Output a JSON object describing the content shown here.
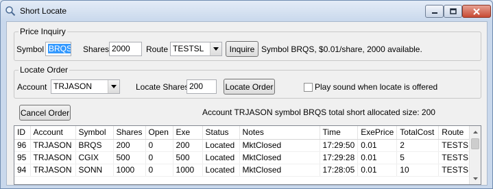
{
  "window": {
    "title": "Short Locate",
    "icon": "search-icon"
  },
  "price_inquiry": {
    "legend": "Price Inquiry",
    "symbol_label": "Symbol",
    "symbol_value": "BRQS",
    "shares_label": "Shares",
    "shares_value": "2000",
    "route_label": "Route",
    "route_value": "TESTSL",
    "inquire_button": "Inquire",
    "result_text": "Symbol BRQS, $0.01/share, 2000 available."
  },
  "locate_order": {
    "legend": "Locate Order",
    "account_label": "Account",
    "account_value": "TRJASON",
    "locate_shares_label": "Locate Shares",
    "locate_shares_value": "200",
    "locate_order_button": "Locate Order",
    "play_sound_label": "Play sound when locate is offered",
    "play_sound_checked": false
  },
  "cancel_order_button": "Cancel Order",
  "summary_text": "Account TRJASON symbol BRQS total short allocated size: 200",
  "table": {
    "columns": [
      "ID",
      "Account",
      "Symbol",
      "Shares",
      "Open",
      "Exe",
      "Status",
      "Notes",
      "Time",
      "ExePrice",
      "TotalCost",
      "Route"
    ],
    "rows": [
      [
        "96",
        "TRJASON",
        "BRQS",
        "200",
        "0",
        "200",
        "Located",
        "MktClosed",
        "17:29:50",
        "0.01",
        "2",
        "TESTSL"
      ],
      [
        "95",
        "TRJASON",
        "CGIX",
        "500",
        "0",
        "500",
        "Located",
        "MktClosed",
        "17:29:28",
        "0.01",
        "5",
        "TESTSL"
      ],
      [
        "94",
        "TRJASON",
        "SONN",
        "1000",
        "0",
        "1000",
        "Located",
        "MktClosed",
        "17:28:05",
        "0.01",
        "10",
        "TESTSL"
      ]
    ]
  }
}
